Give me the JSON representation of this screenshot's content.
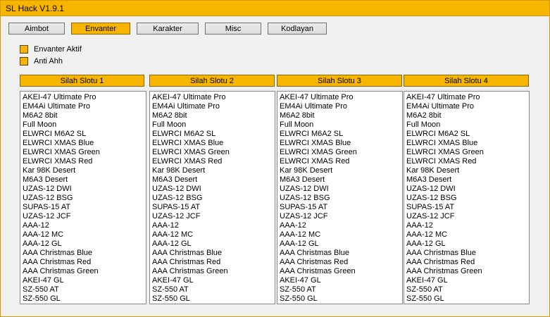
{
  "window": {
    "title": "SL Hack V1.9.1"
  },
  "tabs": [
    {
      "label": "Aimbot"
    },
    {
      "label": "Envanter"
    },
    {
      "label": "Karakter"
    },
    {
      "label": "Misc"
    },
    {
      "label": "Kodlayan"
    }
  ],
  "active_tab": "Envanter",
  "options": [
    {
      "label": "Envanter Aktif"
    },
    {
      "label": "Anti Ahh"
    }
  ],
  "slots": [
    {
      "label": "Silah Slotu 1"
    },
    {
      "label": "Silah Slotu 2"
    },
    {
      "label": "Silah Slotu 3"
    },
    {
      "label": "Silah Slotu 4"
    }
  ],
  "weapons": [
    "AKEI-47 Ultimate Pro",
    "EM4Ai Ultimate Pro",
    "M6A2 8bit",
    "Full Moon",
    "ELWRCI M6A2 SL",
    "ELWRCI XMAS Blue",
    "ELWRCI XMAS Green",
    "ELWRCI XMAS Red",
    "Kar 98K Desert",
    "M6A3 Desert",
    "UZAS-12 DWI",
    "UZAS-12 BSG",
    "SUPAS-15 AT",
    "UZAS-12 JCF",
    "AAA-12",
    "AAA-12 MC",
    "AAA-12 GL",
    "AAA Christmas Blue",
    "AAA Christmas Red",
    "AAA Christmas Green",
    "AKEI-47 GL",
    "SZ-550 AT",
    "SZ-550 GL"
  ],
  "colors": {
    "accent": "#f7b500",
    "window_bg": "#f0f0f0",
    "list_bg": "#ffffff"
  }
}
